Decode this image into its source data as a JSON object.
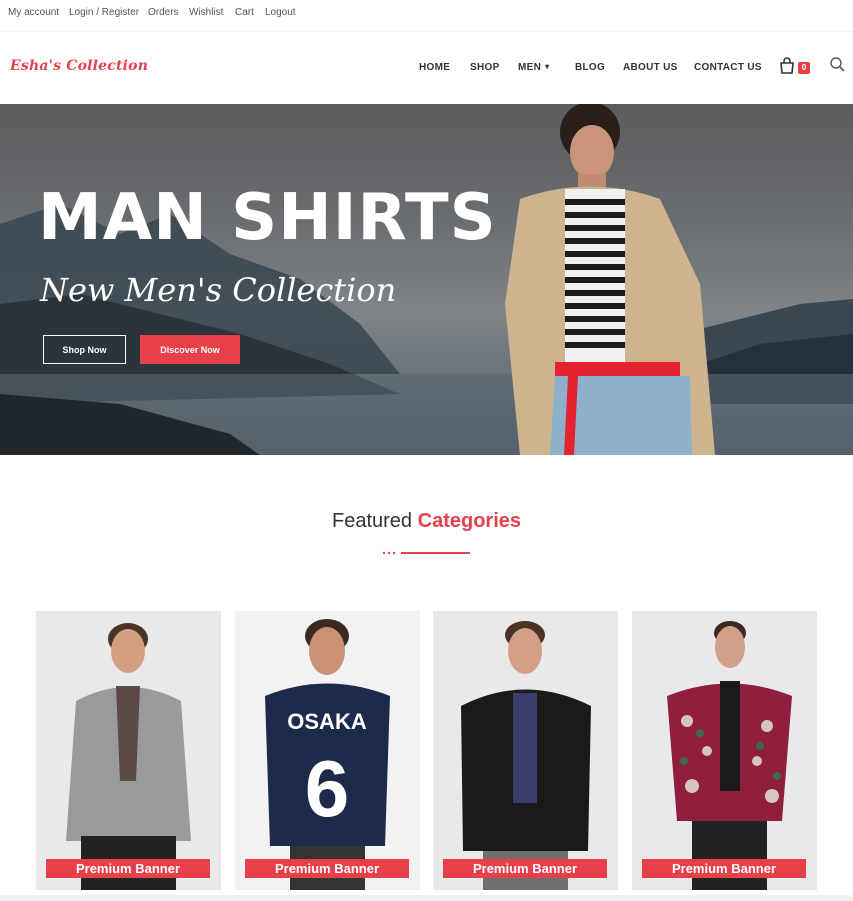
{
  "topbar": {
    "links": [
      "My account",
      "Login / Register",
      "Orders",
      "Wishlist",
      "Cart",
      "Logout"
    ]
  },
  "header": {
    "logo": "Esha's Collection",
    "nav": [
      "HOME",
      "SHOP",
      "MEN",
      "BLOG",
      "ABOUT US",
      "CONTACT US"
    ],
    "cart_count": "0",
    "icons": {
      "cart": "shopping-bag-icon",
      "search": "search-icon",
      "dropdown": "chevron-down-icon"
    }
  },
  "hero": {
    "title": "MAN SHIRTS",
    "subtitle": "New Men's Collection",
    "shop_button": "Shop Now",
    "discover_button": "Discover Now"
  },
  "featured": {
    "title_plain": "Featured",
    "title_accent": "Categories"
  },
  "categories": [
    {
      "label": "Premium Banner"
    },
    {
      "label": "Premium Banner"
    },
    {
      "label": "Premium Banner"
    },
    {
      "label": "Premium Banner"
    }
  ],
  "colors": {
    "accent": "#e8404a",
    "text": "#333333"
  }
}
